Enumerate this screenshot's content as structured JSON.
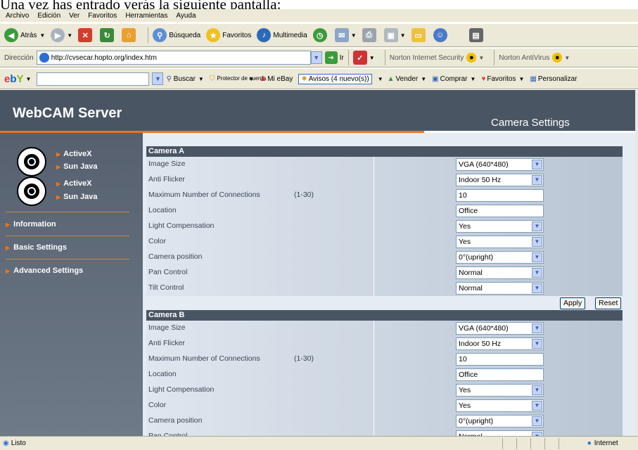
{
  "caption": "Una vez has entrado verás la siguiente pantalla:",
  "menubar": {
    "items": [
      "Archivo",
      "Edición",
      "Ver",
      "Favoritos",
      "Herramientas",
      "Ayuda"
    ]
  },
  "toolbar": {
    "back": "Atrás",
    "search": "Búsqueda",
    "favorites": "Favoritos",
    "multimedia": "Multimedia"
  },
  "address": {
    "label": "Dirección",
    "url": "http://cvsecar.hopto.org/index.htm",
    "go": "Ir",
    "norton_security": "Norton Internet Security",
    "norton_antivirus": "Norton AntiVirus"
  },
  "ebaybar": {
    "buscar": "Buscar",
    "protector": "Protector de cuenta",
    "miebay": "Mi eBay",
    "avisos": "Avisos (4 nuevo(s))",
    "vender": "Vender",
    "comprar": "Comprar",
    "favoritos": "Favoritos",
    "personalizar": "Personalizar"
  },
  "page": {
    "title": "WebCAM Server",
    "subtitle": "Camera Settings",
    "sidebar": {
      "links": [
        "ActiveX",
        "Sun Java",
        "ActiveX",
        "Sun Java"
      ],
      "nav": [
        "Information",
        "Basic Settings",
        "Advanced Settings"
      ]
    },
    "camera_a": {
      "header": "Camera A",
      "rows": [
        {
          "label": "Image Size",
          "range": "",
          "value": "VGA (640*480)",
          "kind": "select"
        },
        {
          "label": "Anti Flicker",
          "range": "",
          "value": "Indoor 50 Hz",
          "kind": "select"
        },
        {
          "label": "Maximum Number of Connections",
          "range": "(1-30)",
          "value": "10",
          "kind": "text"
        },
        {
          "label": "Location",
          "range": "",
          "value": "Office",
          "kind": "text"
        },
        {
          "label": "Light Compensation",
          "range": "",
          "value": "Yes",
          "kind": "select"
        },
        {
          "label": "Color",
          "range": "",
          "value": "Yes",
          "kind": "select"
        },
        {
          "label": "Camera position",
          "range": "",
          "value": "0°(upright)",
          "kind": "select"
        },
        {
          "label": "Pan Control",
          "range": "",
          "value": "Normal",
          "kind": "select"
        },
        {
          "label": "Tilt Control",
          "range": "",
          "value": "Normal",
          "kind": "select"
        }
      ],
      "apply": "Apply",
      "reset": "Reset"
    },
    "camera_b": {
      "header": "Camera B",
      "rows": [
        {
          "label": "Image Size",
          "range": "",
          "value": "VGA (640*480)",
          "kind": "select"
        },
        {
          "label": "Anti Flicker",
          "range": "",
          "value": "Indoor 50 Hz",
          "kind": "select"
        },
        {
          "label": "Maximum Number of Connections",
          "range": "(1-30)",
          "value": "10",
          "kind": "text"
        },
        {
          "label": "Location",
          "range": "",
          "value": "Office",
          "kind": "text"
        },
        {
          "label": "Light Compensation",
          "range": "",
          "value": "Yes",
          "kind": "select"
        },
        {
          "label": "Color",
          "range": "",
          "value": "Yes",
          "kind": "select"
        },
        {
          "label": "Camera position",
          "range": "",
          "value": "0°(upright)",
          "kind": "select"
        },
        {
          "label": "Pan Control",
          "range": "",
          "value": "Normal",
          "kind": "select"
        }
      ]
    }
  },
  "status": {
    "left": "Listo",
    "zone": "Internet"
  }
}
